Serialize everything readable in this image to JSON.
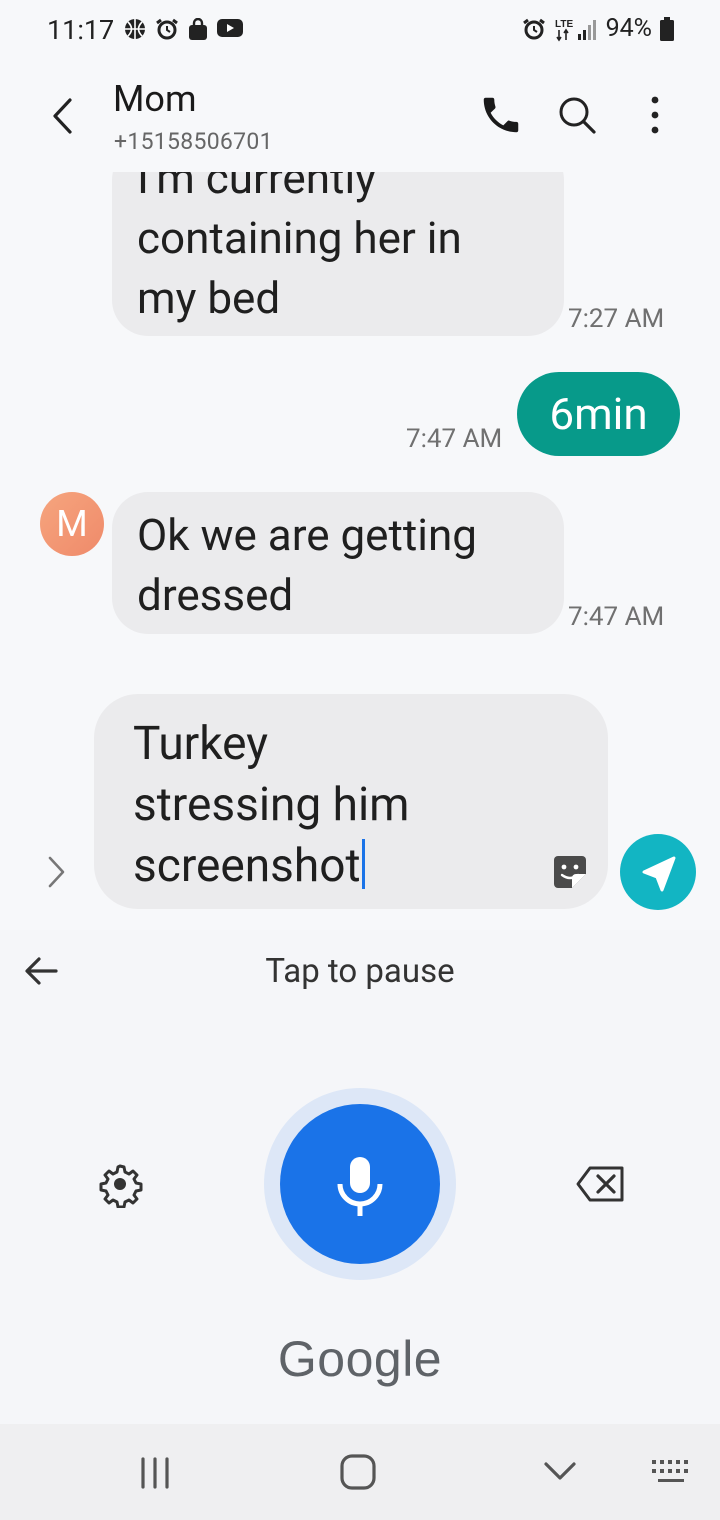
{
  "status_bar": {
    "time": "11:17",
    "battery": "94%",
    "network": "LTE"
  },
  "header": {
    "contact_name": "Mom",
    "contact_number": "+15158506701",
    "icons": [
      "back-icon",
      "phone-icon",
      "search-icon",
      "more-vert-icon"
    ]
  },
  "conversation": {
    "messages": [
      {
        "direction": "incoming",
        "lines": [
          "I'm currently",
          "containing her in",
          "my bed"
        ],
        "time": "7:27 AM"
      },
      {
        "direction": "outgoing",
        "text": "6min",
        "time": "7:47 AM"
      },
      {
        "direction": "incoming",
        "avatar_letter": "M",
        "lines": [
          "Ok we are getting",
          "dressed"
        ],
        "time": "7:47 AM"
      }
    ]
  },
  "compose": {
    "lines": [
      "Turkey",
      "stressing him",
      "screenshot"
    ]
  },
  "voice_input": {
    "status": "Tap to pause",
    "brand": "Google"
  },
  "colors": {
    "outgoing_bubble": "#079a8a",
    "send_button": "#12b5c3",
    "mic_button": "#1a73e8",
    "incoming_bubble": "#ebebed"
  }
}
